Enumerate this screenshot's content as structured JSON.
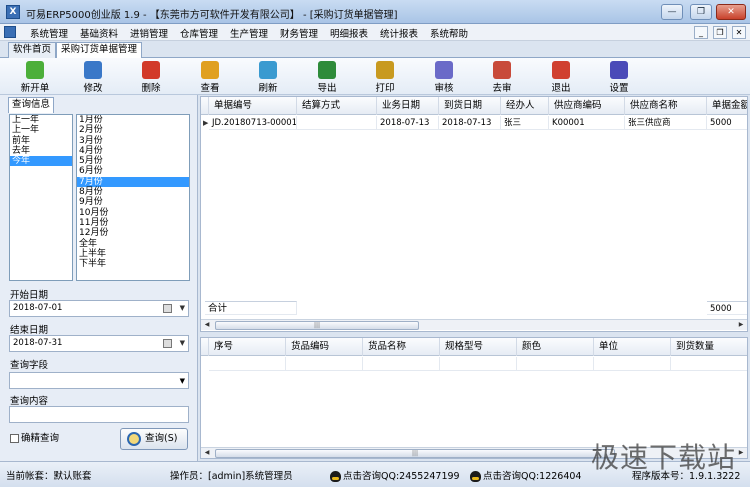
{
  "window": {
    "title": "可易ERP5000创业版 1.9 - 【东莞市方可软件开发有限公司】 - [采购订货单据管理]",
    "min": "—",
    "restore": "❐",
    "close": "✕"
  },
  "menu": [
    "系统管理",
    "基础资料",
    "进销管理",
    "仓库管理",
    "生产管理",
    "财务管理",
    "明细报表",
    "统计报表",
    "系统帮助"
  ],
  "mdi_controls": [
    "_",
    "❐",
    "✕"
  ],
  "tabs": [
    "软件首页",
    "采购订货单据管理"
  ],
  "toolbar": [
    {
      "label": "新开单",
      "icon": "new-document-icon",
      "color": "#4caf3a"
    },
    {
      "label": "修改",
      "icon": "edit-gear-icon",
      "color": "#3a78c8"
    },
    {
      "label": "删除",
      "icon": "delete-icon",
      "color": "#d23a2a"
    },
    {
      "label": "查看",
      "icon": "magnifier-icon",
      "color": "#e0a020"
    },
    {
      "label": "刷新",
      "icon": "refresh-icon",
      "color": "#3a9ad0"
    },
    {
      "label": "导出",
      "icon": "excel-export-icon",
      "color": "#2e8b3a"
    },
    {
      "label": "打印",
      "icon": "print-preview-icon",
      "color": "#c89a20"
    },
    {
      "label": "审核",
      "icon": "audit-icon",
      "color": "#6a6ac8"
    },
    {
      "label": "去审",
      "icon": "unaudit-icon",
      "color": "#c84a3a"
    },
    {
      "label": "退出",
      "icon": "exit-icon",
      "color": "#d04030"
    },
    {
      "label": "设置",
      "icon": "settings-grid-icon",
      "color": "#4a4ab8"
    }
  ],
  "query": {
    "tab_label": "查询信息",
    "periods": [
      "上一年",
      "上一年",
      "前年",
      "去年",
      "今年"
    ],
    "selected_period": 4,
    "months": [
      "1月份",
      "2月份",
      "3月份",
      "4月份",
      "5月份",
      "6月份",
      "7月份",
      "8月份",
      "9月份",
      "10月份",
      "11月份",
      "12月份",
      "全年",
      "上半年",
      "下半年"
    ],
    "selected_month": 6,
    "start_label": "开始日期",
    "start_value": "2018-07-01",
    "end_label": "结束日期",
    "end_value": "2018-07-31",
    "field_label": "查询字段",
    "content_label": "查询内容",
    "exact_label": "确精查询",
    "query_button": "查询(S)"
  },
  "main_grid": {
    "columns": [
      "单据编号",
      "结算方式",
      "业务日期",
      "到货日期",
      "经办人",
      "供应商编码",
      "供应商名称",
      "单据金额"
    ],
    "rows": [
      [
        "JD.20180713-00001",
        "",
        "2018-07-13",
        "2018-07-13",
        "张三",
        "K00001",
        "张三供应商",
        "5000"
      ]
    ],
    "footer_label": "合计",
    "footer_total": "5000"
  },
  "detail_grid": {
    "columns": [
      "序号",
      "货品编码",
      "货品名称",
      "规格型号",
      "颜色",
      "单位",
      "到货数量"
    ]
  },
  "status": {
    "account": "当前帐套：默认账套",
    "operator": "操作员：[admin]系统管理员",
    "qq1": "点击咨询QQ:2455247199",
    "qq2": "点击咨询QQ:1226404",
    "version": "程序版本号：1.9.1.3222"
  },
  "watermark": "极速下载站"
}
